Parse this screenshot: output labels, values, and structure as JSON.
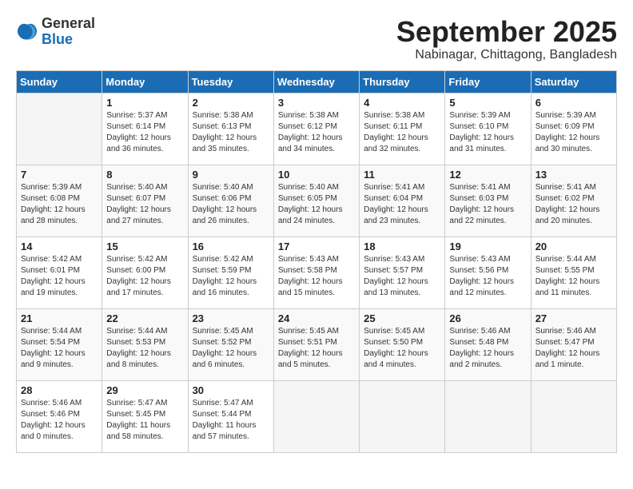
{
  "header": {
    "logo": {
      "general": "General",
      "blue": "Blue"
    },
    "title": "September 2025",
    "location": "Nabinagar, Chittagong, Bangladesh"
  },
  "weekdays": [
    "Sunday",
    "Monday",
    "Tuesday",
    "Wednesday",
    "Thursday",
    "Friday",
    "Saturday"
  ],
  "weeks": [
    [
      {
        "day": "",
        "content": ""
      },
      {
        "day": "1",
        "content": "Sunrise: 5:37 AM\nSunset: 6:14 PM\nDaylight: 12 hours\nand 36 minutes."
      },
      {
        "day": "2",
        "content": "Sunrise: 5:38 AM\nSunset: 6:13 PM\nDaylight: 12 hours\nand 35 minutes."
      },
      {
        "day": "3",
        "content": "Sunrise: 5:38 AM\nSunset: 6:12 PM\nDaylight: 12 hours\nand 34 minutes."
      },
      {
        "day": "4",
        "content": "Sunrise: 5:38 AM\nSunset: 6:11 PM\nDaylight: 12 hours\nand 32 minutes."
      },
      {
        "day": "5",
        "content": "Sunrise: 5:39 AM\nSunset: 6:10 PM\nDaylight: 12 hours\nand 31 minutes."
      },
      {
        "day": "6",
        "content": "Sunrise: 5:39 AM\nSunset: 6:09 PM\nDaylight: 12 hours\nand 30 minutes."
      }
    ],
    [
      {
        "day": "7",
        "content": "Sunrise: 5:39 AM\nSunset: 6:08 PM\nDaylight: 12 hours\nand 28 minutes."
      },
      {
        "day": "8",
        "content": "Sunrise: 5:40 AM\nSunset: 6:07 PM\nDaylight: 12 hours\nand 27 minutes."
      },
      {
        "day": "9",
        "content": "Sunrise: 5:40 AM\nSunset: 6:06 PM\nDaylight: 12 hours\nand 26 minutes."
      },
      {
        "day": "10",
        "content": "Sunrise: 5:40 AM\nSunset: 6:05 PM\nDaylight: 12 hours\nand 24 minutes."
      },
      {
        "day": "11",
        "content": "Sunrise: 5:41 AM\nSunset: 6:04 PM\nDaylight: 12 hours\nand 23 minutes."
      },
      {
        "day": "12",
        "content": "Sunrise: 5:41 AM\nSunset: 6:03 PM\nDaylight: 12 hours\nand 22 minutes."
      },
      {
        "day": "13",
        "content": "Sunrise: 5:41 AM\nSunset: 6:02 PM\nDaylight: 12 hours\nand 20 minutes."
      }
    ],
    [
      {
        "day": "14",
        "content": "Sunrise: 5:42 AM\nSunset: 6:01 PM\nDaylight: 12 hours\nand 19 minutes."
      },
      {
        "day": "15",
        "content": "Sunrise: 5:42 AM\nSunset: 6:00 PM\nDaylight: 12 hours\nand 17 minutes."
      },
      {
        "day": "16",
        "content": "Sunrise: 5:42 AM\nSunset: 5:59 PM\nDaylight: 12 hours\nand 16 minutes."
      },
      {
        "day": "17",
        "content": "Sunrise: 5:43 AM\nSunset: 5:58 PM\nDaylight: 12 hours\nand 15 minutes."
      },
      {
        "day": "18",
        "content": "Sunrise: 5:43 AM\nSunset: 5:57 PM\nDaylight: 12 hours\nand 13 minutes."
      },
      {
        "day": "19",
        "content": "Sunrise: 5:43 AM\nSunset: 5:56 PM\nDaylight: 12 hours\nand 12 minutes."
      },
      {
        "day": "20",
        "content": "Sunrise: 5:44 AM\nSunset: 5:55 PM\nDaylight: 12 hours\nand 11 minutes."
      }
    ],
    [
      {
        "day": "21",
        "content": "Sunrise: 5:44 AM\nSunset: 5:54 PM\nDaylight: 12 hours\nand 9 minutes."
      },
      {
        "day": "22",
        "content": "Sunrise: 5:44 AM\nSunset: 5:53 PM\nDaylight: 12 hours\nand 8 minutes."
      },
      {
        "day": "23",
        "content": "Sunrise: 5:45 AM\nSunset: 5:52 PM\nDaylight: 12 hours\nand 6 minutes."
      },
      {
        "day": "24",
        "content": "Sunrise: 5:45 AM\nSunset: 5:51 PM\nDaylight: 12 hours\nand 5 minutes."
      },
      {
        "day": "25",
        "content": "Sunrise: 5:45 AM\nSunset: 5:50 PM\nDaylight: 12 hours\nand 4 minutes."
      },
      {
        "day": "26",
        "content": "Sunrise: 5:46 AM\nSunset: 5:48 PM\nDaylight: 12 hours\nand 2 minutes."
      },
      {
        "day": "27",
        "content": "Sunrise: 5:46 AM\nSunset: 5:47 PM\nDaylight: 12 hours\nand 1 minute."
      }
    ],
    [
      {
        "day": "28",
        "content": "Sunrise: 5:46 AM\nSunset: 5:46 PM\nDaylight: 12 hours\nand 0 minutes."
      },
      {
        "day": "29",
        "content": "Sunrise: 5:47 AM\nSunset: 5:45 PM\nDaylight: 11 hours\nand 58 minutes."
      },
      {
        "day": "30",
        "content": "Sunrise: 5:47 AM\nSunset: 5:44 PM\nDaylight: 11 hours\nand 57 minutes."
      },
      {
        "day": "",
        "content": ""
      },
      {
        "day": "",
        "content": ""
      },
      {
        "day": "",
        "content": ""
      },
      {
        "day": "",
        "content": ""
      }
    ]
  ]
}
